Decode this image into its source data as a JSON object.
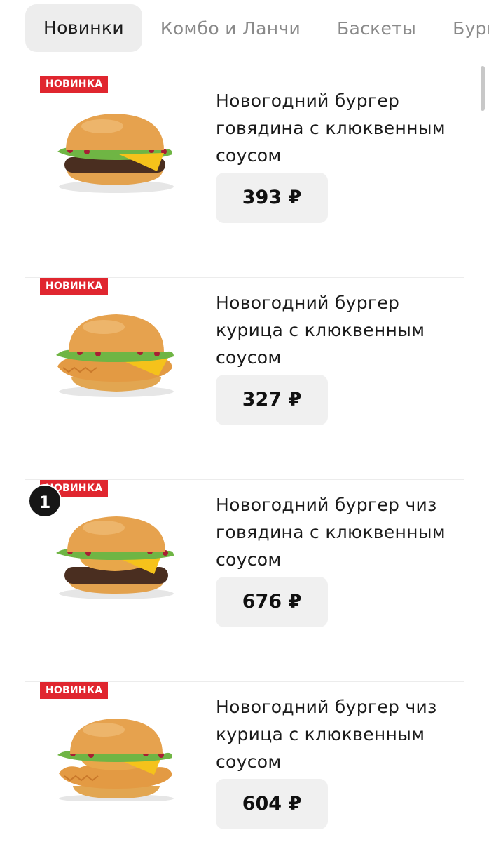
{
  "tabs": [
    {
      "label": "Новинки",
      "active": true
    },
    {
      "label": "Комбо и Ланчи",
      "active": false
    },
    {
      "label": "Баскеты",
      "active": false
    },
    {
      "label": "Бургеры",
      "active": false
    }
  ],
  "products": [
    {
      "badge": "НОВИНКА",
      "name": "Новогодний бургер говядина с клюквенным соусом",
      "price": "393 ₽",
      "image": "beef-burger-icon"
    },
    {
      "badge": "НОВИНКА",
      "name": "Новогодний бургер курица с клюквенным соусом",
      "price": "327 ₽",
      "image": "chicken-burger-icon"
    },
    {
      "badge": "НОВИНКА",
      "name": "Новогодний бургер чиз говядина с клюквенным соусом",
      "price": "676 ₽",
      "image": "cheese-beef-burger-icon",
      "cart_count": "1"
    },
    {
      "badge": "НОВИНКА",
      "name": "Новогодний бургер чиз курица с клюквенным соусом",
      "price": "604 ₽",
      "image": "cheese-chicken-burger-icon"
    }
  ],
  "colors": {
    "badge": "#e0262f",
    "active_tab_bg": "#ededed",
    "price_bg": "#f0f0f0",
    "counter_bg": "#161616"
  }
}
